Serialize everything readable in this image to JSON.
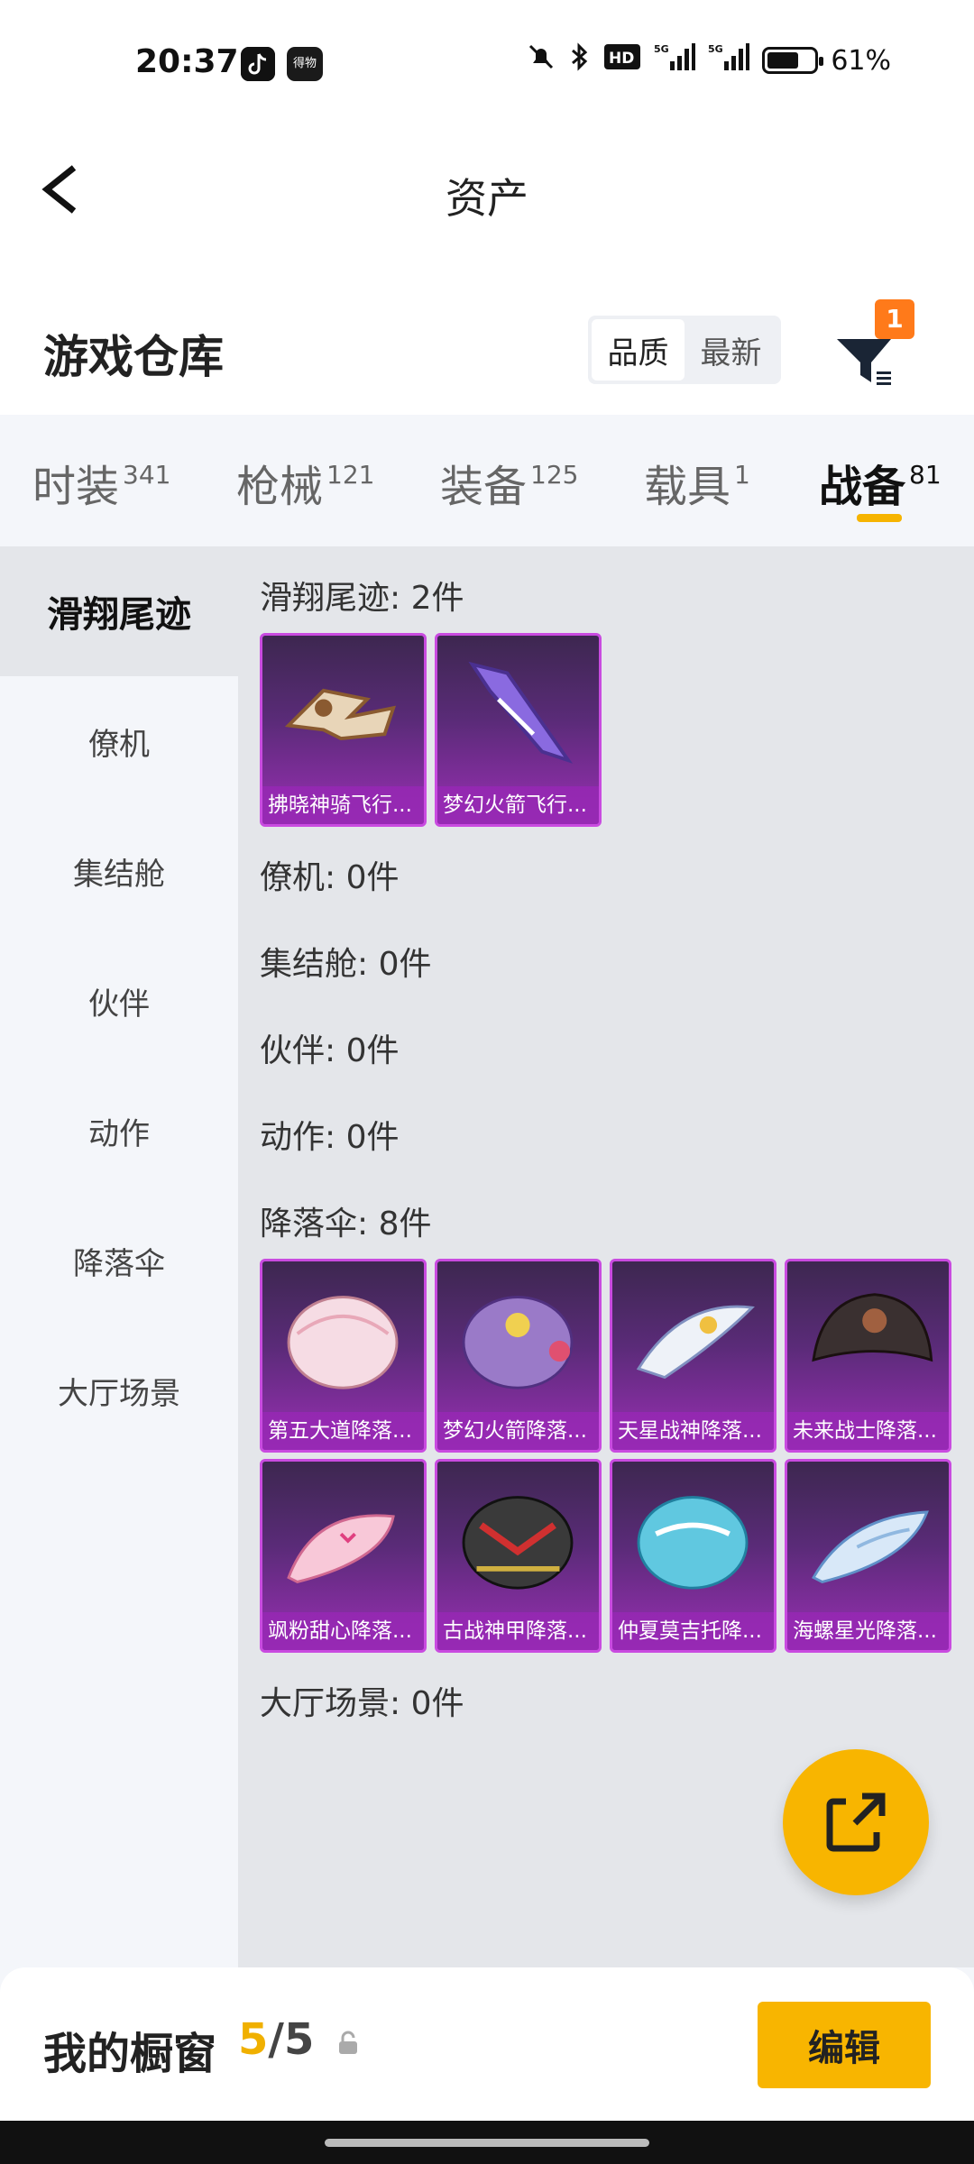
{
  "status_bar": {
    "time": "20:37",
    "app_icon_label": "得物",
    "battery_percent": "61%",
    "icons": [
      "tiktok-icon",
      "app-icon",
      "mute-icon",
      "bluetooth-icon",
      "hd-icon",
      "5g-signal-icon",
      "5g-signal-icon",
      "battery-icon"
    ]
  },
  "header": {
    "title": "资产",
    "back_icon": "chevron-left-icon"
  },
  "warehouse": {
    "title": "游戏仓库",
    "sort_options": [
      "品质",
      "最新"
    ],
    "filter_badge": "1"
  },
  "tabs": [
    {
      "label": "时装",
      "count": "341"
    },
    {
      "label": "枪械",
      "count": "121"
    },
    {
      "label": "装备",
      "count": "125"
    },
    {
      "label": "载具",
      "count": "1"
    },
    {
      "label": "战备",
      "count": "81"
    }
  ],
  "sidenav": [
    "滑翔尾迹",
    "僚机",
    "集结舱",
    "伙伴",
    "动作",
    "降落伞",
    "大厅场景"
  ],
  "sections": {
    "glide_trail": {
      "title": "滑翔尾迹: 2件",
      "items": [
        "拂晓神骑飞行...",
        "梦幻火箭飞行..."
      ]
    },
    "wingman": {
      "title": "僚机: 0件"
    },
    "pod": {
      "title": "集结舱: 0件"
    },
    "partner": {
      "title": "伙伴: 0件"
    },
    "action": {
      "title": "动作: 0件"
    },
    "parachute": {
      "title": "降落伞: 8件",
      "items": [
        "第五大道降落...",
        "梦幻火箭降落...",
        "天星战神降落...",
        "未来战士降落...",
        "飒粉甜心降落...",
        "古战神甲降落...",
        "仲夏莫吉托降...",
        "海螺星光降落..."
      ]
    },
    "lobby": {
      "title": "大厅场景: 0件"
    }
  },
  "fab_icon": "share-icon",
  "bottom": {
    "label": "我的橱窗",
    "current": "5",
    "separator": "/",
    "total": "5",
    "edit_label": "编辑"
  },
  "colors": {
    "accent": "#f8b500",
    "card_border": "#c94be0",
    "badge": "#ff7a1a"
  }
}
